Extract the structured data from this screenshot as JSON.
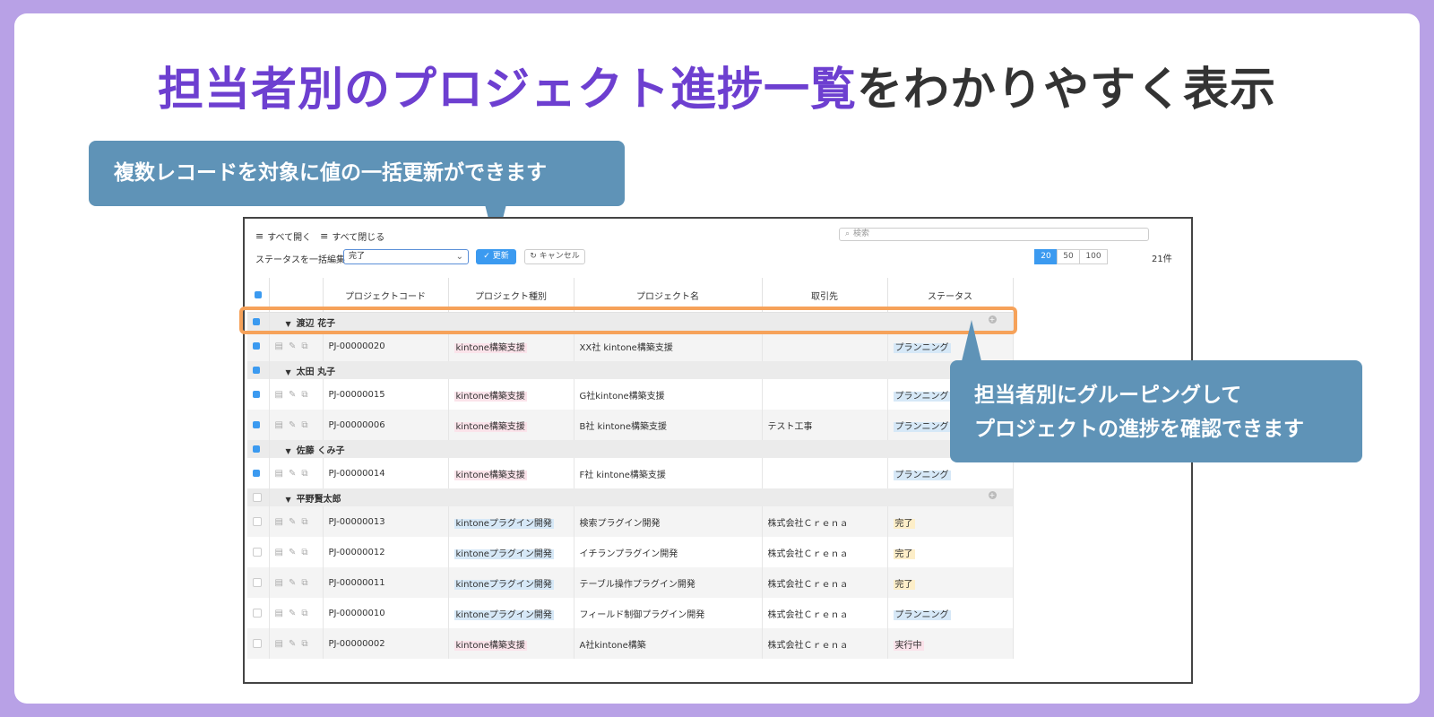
{
  "headline": {
    "accent": "担当者別のプロジェクト進捗一覧",
    "rest": "をわかりやすく表示"
  },
  "callouts": {
    "top": "複数レコードを対象に値の一括更新ができます",
    "right_line1": "担当者別にグルーピングして",
    "right_line2": "プロジェクトの進捗を確認できます"
  },
  "toolbar": {
    "expand_all": "すべて開く",
    "collapse_all": "すべて閉じる",
    "search_placeholder": "検索",
    "bulk_label": "ステータスを一括編集",
    "bulk_value": "完了",
    "update_label": "✓ 更新",
    "cancel_label": "↻ キャンセル",
    "page_sizes": [
      "20",
      "50",
      "100"
    ],
    "record_count": "21件"
  },
  "columns": [
    "プロジェクトコード",
    "プロジェクト種別",
    "プロジェクト名",
    "取引先",
    "ステータス"
  ],
  "groups": [
    {
      "name": "渡辺 花子",
      "checked": true,
      "rows": [
        {
          "code": "PJ-00000020",
          "type": "kintone構築支援",
          "name": "XX社 kintone構築支援",
          "client": "",
          "status": "プランニング",
          "checked": true
        }
      ]
    },
    {
      "name": "太田 丸子",
      "checked": true,
      "rows": [
        {
          "code": "PJ-00000015",
          "type": "kintone構築支援",
          "name": "G社kintone構築支援",
          "client": "",
          "status": "プランニング",
          "checked": true
        },
        {
          "code": "PJ-00000006",
          "type": "kintone構築支援",
          "name": "B社 kintone構築支援",
          "client": "テスト工事",
          "status": "プランニング",
          "checked": true
        }
      ]
    },
    {
      "name": "佐藤 くみ子",
      "checked": true,
      "rows": [
        {
          "code": "PJ-00000014",
          "type": "kintone構築支援",
          "name": "F社 kintone構築支援",
          "client": "",
          "status": "プランニング",
          "checked": true
        }
      ]
    },
    {
      "name": "平野賢太郎",
      "checked": false,
      "rows": [
        {
          "code": "PJ-00000013",
          "type": "kintoneプラグイン開発",
          "name": "検索プラグイン開発",
          "client": "株式会社Ｃｒｅｎａ",
          "status": "完了",
          "checked": false
        },
        {
          "code": "PJ-00000012",
          "type": "kintoneプラグイン開発",
          "name": "イチランプラグイン開発",
          "client": "株式会社Ｃｒｅｎａ",
          "status": "完了",
          "checked": false
        },
        {
          "code": "PJ-00000011",
          "type": "kintoneプラグイン開発",
          "name": "テーブル操作プラグイン開発",
          "client": "株式会社Ｃｒｅｎａ",
          "status": "完了",
          "checked": false
        },
        {
          "code": "PJ-00000010",
          "type": "kintoneプラグイン開発",
          "name": "フィールド制御プラグイン開発",
          "client": "株式会社Ｃｒｅｎａ",
          "status": "プランニング",
          "checked": false
        },
        {
          "code": "PJ-00000002",
          "type": "kintone構築支援",
          "name": "A社kintone構築",
          "client": "株式会社Ｃｒｅｎａ",
          "status": "実行中",
          "checked": false
        }
      ]
    }
  ],
  "colors": {
    "frame": "#b8a1e6",
    "accent": "#6d3fd0",
    "callout": "#5f93b7",
    "highlight": "#f6a25a",
    "primary_button": "#3b9af0"
  }
}
